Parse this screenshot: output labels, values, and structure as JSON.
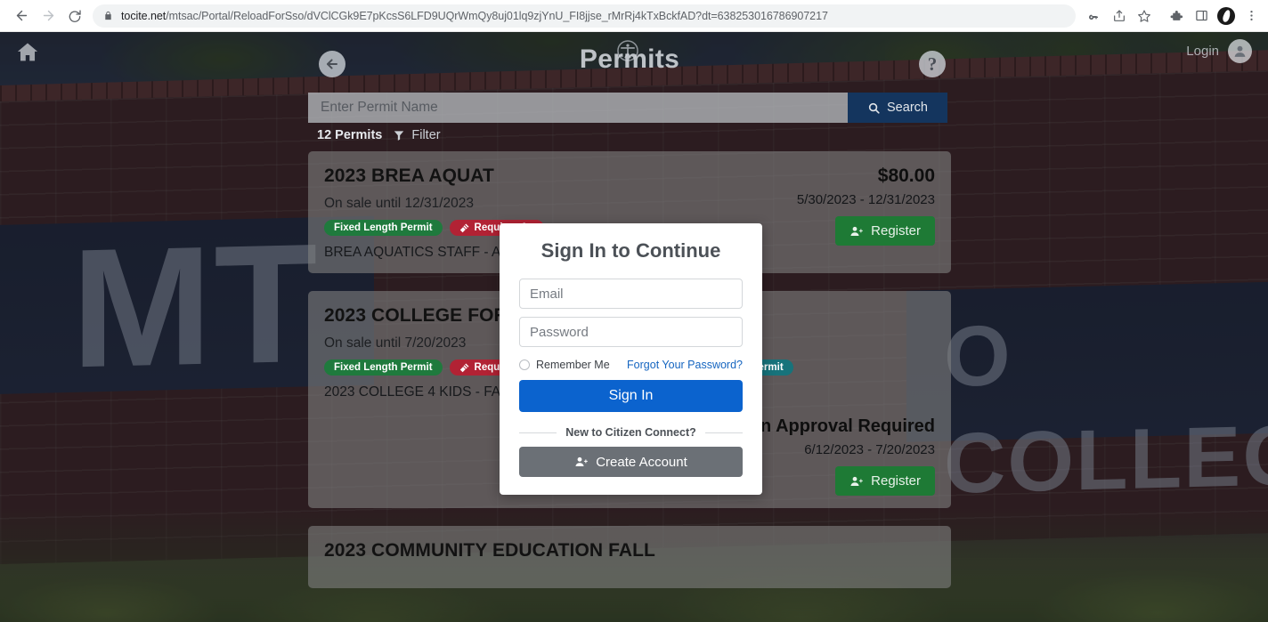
{
  "browser": {
    "back_label": "Back",
    "forward_label": "Forward",
    "reload_label": "Reload",
    "url_host": "tocite.net",
    "url_path": "/mtsac/Portal/ReloadForSso/dVClCGk9E7pKcsS6LFD9UQrWmQy8uj01lq9zjYnU_FI8jjse_rMrRj4kTxBckfAD?dt=638253016786907217",
    "icons": {
      "lock": "lock-icon",
      "password_key": "key-icon",
      "share": "share-icon",
      "bookmark": "star-icon",
      "extensions": "puzzle-icon",
      "sidepanel": "square-panel-icon",
      "profile": "profile-avatar-icon",
      "menu": "kebab-menu-icon"
    }
  },
  "site_topbar": {
    "home_icon": "home-icon",
    "accessibility_icon": "accessibility-icon",
    "login_label": "Login",
    "login_avatar_icon": "user-avatar-icon"
  },
  "header": {
    "title": "Permits",
    "back_icon": "arrow-left-circle-icon",
    "help_icon": "question-mark-icon"
  },
  "search": {
    "placeholder": "Enter Permit Name",
    "value": "",
    "button_label": "Search",
    "button_icon": "magnifier-icon"
  },
  "results_meta": {
    "count_label": "12 Permits",
    "filter_label": "Filter",
    "filter_icon": "funnel-icon"
  },
  "permits": [
    {
      "title": "2023 BREA AQUAT",
      "on_sale": "On sale until 12/31/2023",
      "badges": [
        {
          "label": "Fixed Length Permit",
          "color": "green",
          "icon": null
        },
        {
          "label": "Requires Ap",
          "color": "red",
          "icon": "gavel-icon"
        }
      ],
      "description": "BREA AQUATICS STAFF - ADM",
      "price": "$80.00",
      "dates": "5/30/2023 - 12/31/2023",
      "register_label": "Register",
      "register_icon": "user-plus-icon"
    },
    {
      "title": "2023 COLLEGE FOR",
      "on_sale": "On sale until 7/20/2023",
      "badges": [
        {
          "label": "Fixed Length Permit",
          "color": "green",
          "icon": null
        },
        {
          "label": "Requires Ap",
          "color": "red",
          "icon": "gavel-icon"
        },
        {
          "label": "Permit",
          "color": "teal",
          "icon": null
        }
      ],
      "description": "2023 COLLEGE 4 KIDS - FACUL",
      "approval_title": "Admin Approval Required",
      "dates": "6/12/2023 - 7/20/2023",
      "register_label": "Register",
      "register_icon": "user-plus-icon"
    },
    {
      "title": "2023 COMMUNITY EDUCATION FALL"
    }
  ],
  "modal": {
    "title": "Sign In to Continue",
    "email_placeholder": "Email",
    "email_value": "",
    "password_placeholder": "Password",
    "password_value": "",
    "remember_label": "Remember Me",
    "forgot_label": "Forgot Your Password?",
    "signin_label": "Sign In",
    "divider_label": "New to Citizen Connect?",
    "create_label": "Create Account",
    "create_icon": "user-plus-icon"
  },
  "background": {
    "sign_left_text": "MT",
    "sign_right_text": "O COLLEGE"
  },
  "colors": {
    "search_button": "#14355e",
    "signin_button": "#0b63ce",
    "register_button": "#1e7a35",
    "create_button": "#6b7076",
    "badge_green": "#1f7a3d",
    "badge_red": "#b22234",
    "badge_teal": "#17737b",
    "link_blue": "#1565c0"
  }
}
